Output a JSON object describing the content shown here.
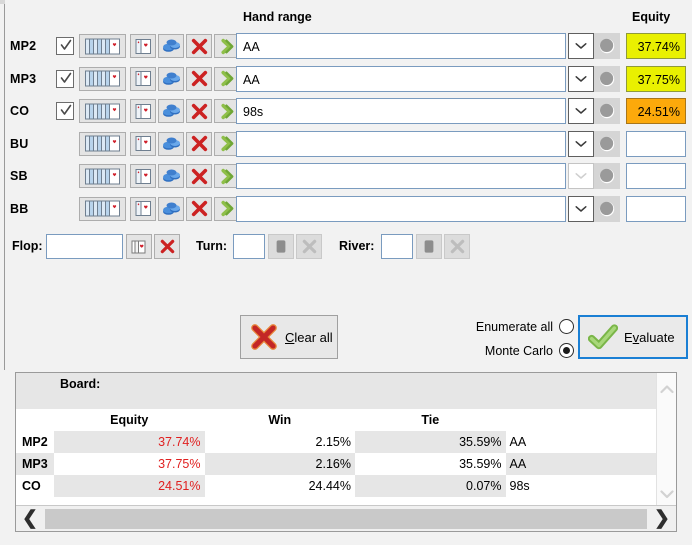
{
  "headers": {
    "hand_range": "Hand range",
    "equity": "Equity"
  },
  "rows": [
    {
      "position": "MP2",
      "has_checkbox": true,
      "checked": true,
      "range": "AA",
      "equity": "37.74%",
      "equity_style": "yellow",
      "combo_dim": false
    },
    {
      "position": "MP3",
      "has_checkbox": true,
      "checked": true,
      "range": "AA",
      "equity": "37.75%",
      "equity_style": "yellow",
      "combo_dim": false
    },
    {
      "position": "CO",
      "has_checkbox": true,
      "checked": true,
      "range": "98s",
      "equity": "24.51%",
      "equity_style": "orange",
      "combo_dim": false
    },
    {
      "position": "BU",
      "has_checkbox": false,
      "checked": false,
      "range": "",
      "equity": "",
      "equity_style": "plain",
      "combo_dim": false
    },
    {
      "position": "SB",
      "has_checkbox": false,
      "checked": false,
      "range": "",
      "equity": "",
      "equity_style": "plain",
      "combo_dim": true
    },
    {
      "position": "BB",
      "has_checkbox": false,
      "checked": false,
      "range": "",
      "equity": "",
      "equity_style": "plain",
      "combo_dim": false
    }
  ],
  "board": {
    "flop_label": "Flop:",
    "flop_value": "",
    "turn_label": "Turn:",
    "turn_value": "",
    "river_label": "River:",
    "river_value": ""
  },
  "actions": {
    "clear_all_label": "Clear all",
    "clear_all_mnemonic": "C",
    "evaluate_label": "Evaluate",
    "evaluate_mnemonic": "v",
    "enumerate_label": "Enumerate all",
    "monte_carlo_label": "Monte Carlo",
    "mode_selected": "Monte Carlo"
  },
  "results": {
    "board_label": "Board:",
    "board_value": "",
    "columns": [
      "Equity",
      "Win",
      "Tie"
    ],
    "rows": [
      {
        "position": "MP2",
        "equity": "37.74%",
        "win": "2.15%",
        "tie": "35.59%",
        "hand": "AA"
      },
      {
        "position": "MP3",
        "equity": "37.75%",
        "win": "2.16%",
        "tie": "35.59%",
        "hand": "AA"
      },
      {
        "position": "CO",
        "equity": "24.51%",
        "win": "24.44%",
        "tie": "0.07%",
        "hand": "98s"
      }
    ]
  },
  "colors": {
    "equity_yellow": "#e9f000",
    "equity_orange": "#fca90b",
    "equity_text_red": "#e02020",
    "focus_blue": "#1a7fd4",
    "panel_bg": "#f2f2f2"
  }
}
